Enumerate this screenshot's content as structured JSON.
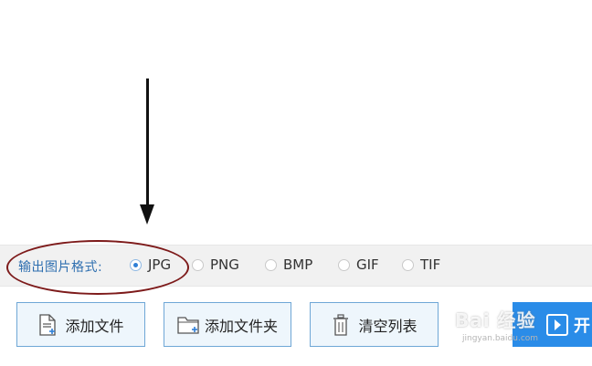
{
  "output_format": {
    "label": "输出图片格式:",
    "options": [
      "JPG",
      "PNG",
      "BMP",
      "GIF",
      "TIF"
    ],
    "selected": "JPG"
  },
  "buttons": {
    "add_file": "添加文件",
    "add_folder": "添加文件夹",
    "clear_list": "清空列表",
    "start": "开"
  },
  "watermark": {
    "text": "Bai 经验",
    "sub": "jingyan.baidu.com"
  },
  "colors": {
    "accent": "#2f7fd6",
    "start_button": "#2a8ce8",
    "annotation": "#7d1a1a"
  },
  "icons": [
    "add-file-icon",
    "add-folder-icon",
    "trash-icon",
    "start-icon"
  ]
}
